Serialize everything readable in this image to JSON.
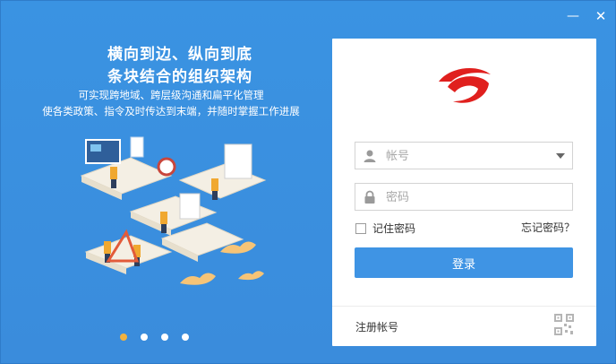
{
  "window": {
    "minimize_glyph": "—",
    "close_glyph": "✕"
  },
  "hero": {
    "title_line1": "横向到边、纵向到底",
    "title_line2": "条块结合的组织架构",
    "desc_line1": "可实现跨地域、跨层级沟通和扁平化管理",
    "desc_line2": "使各类政策、指令及时传达到末端，并随时掌握工作进展"
  },
  "carousel": {
    "count": 4,
    "active_index": 0
  },
  "login": {
    "account_placeholder": "帐号",
    "password_placeholder": "密码",
    "remember_label": "记住密码",
    "remember_checked": false,
    "forgot_label": "忘记密码？",
    "login_button": "登录",
    "register_label": "注册帐号"
  },
  "colors": {
    "brand_blue": "#3a8fde",
    "button_blue": "#3f94e4",
    "logo_red": "#e0201e",
    "active_dot": "#f2b23f"
  }
}
